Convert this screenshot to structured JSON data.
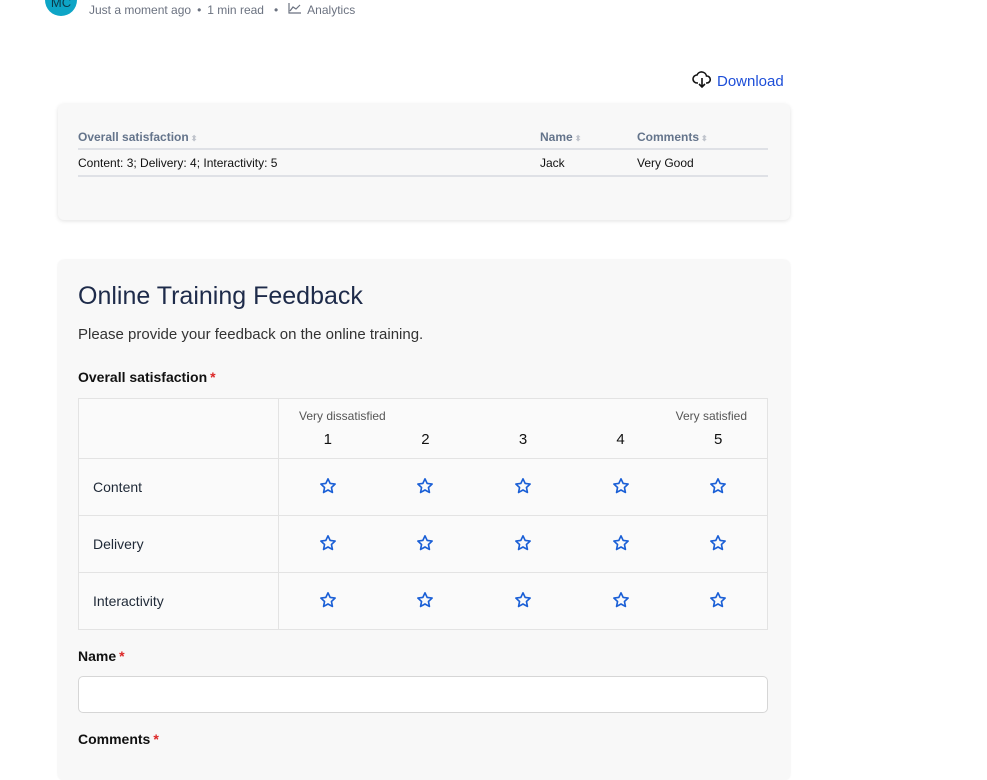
{
  "header": {
    "avatar": "MC",
    "time": "Just a moment ago",
    "read": "1 min read",
    "category": "Analytics"
  },
  "download_label": "Download",
  "results": {
    "columns": [
      "Overall satisfaction",
      "Name",
      "Comments"
    ],
    "rows": [
      [
        "Content: 3; Delivery: 4; Interactivity: 5",
        "Jack",
        "Very Good"
      ]
    ]
  },
  "form": {
    "title": "Online Training Feedback",
    "description": "Please provide your feedback on the online training.",
    "q1": {
      "label": "Overall satisfaction",
      "min_text": "Very dissatisfied",
      "max_text": "Very satisfied",
      "scale": [
        "1",
        "2",
        "3",
        "4",
        "5"
      ],
      "rows": [
        "Content",
        "Delivery",
        "Interactivity"
      ]
    },
    "q2": {
      "label": "Name",
      "value": ""
    },
    "q3": {
      "label": "Comments"
    },
    "required_mark": "*",
    "accent": "#1a5fd6"
  }
}
